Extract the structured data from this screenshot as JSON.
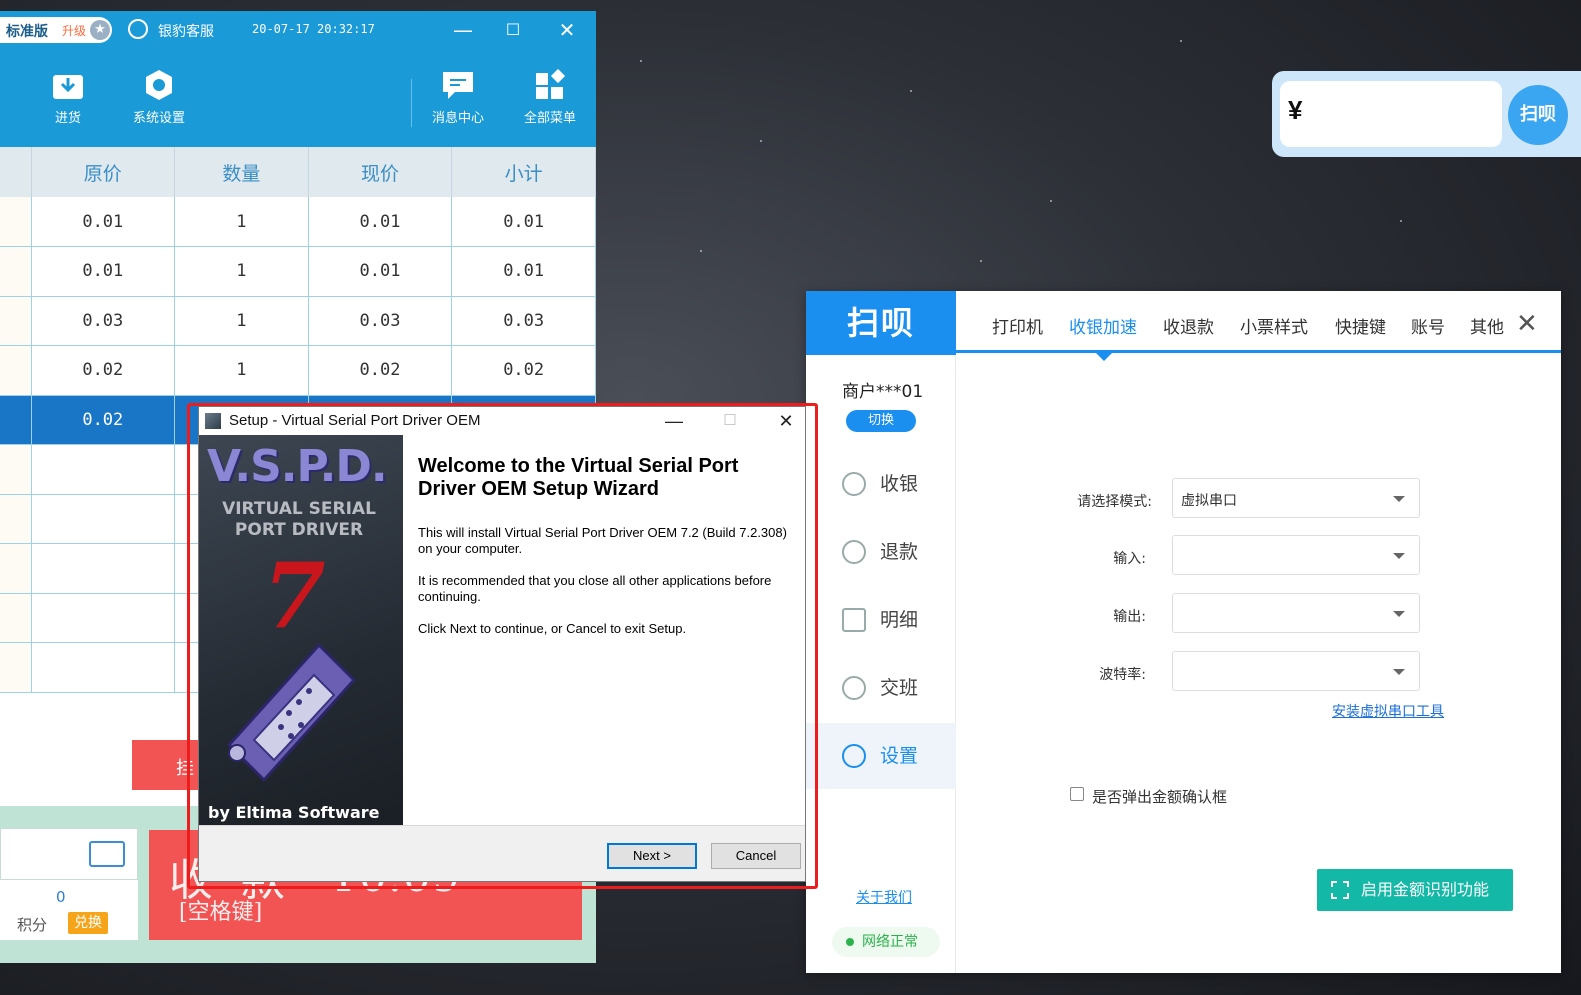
{
  "pos": {
    "edition": "标准版",
    "upgrade": "升级",
    "service": "银豹客服",
    "datetime": "20-07-17 20:32:17",
    "controls": {
      "minimize": "—",
      "maximize": "☐",
      "close": "✕"
    },
    "toolbar": {
      "purchase": "进货",
      "system_settings": "系统设置",
      "message_center": "消息中心",
      "all_menus": "全部菜单"
    },
    "table": {
      "headers": [
        "原价",
        "数量",
        "现价",
        "小计"
      ],
      "rows": [
        [
          "0.01",
          "1",
          "0.01",
          "0.01"
        ],
        [
          "0.01",
          "1",
          "0.01",
          "0.01"
        ],
        [
          "0.03",
          "1",
          "0.03",
          "0.03"
        ],
        [
          "0.02",
          "1",
          "0.02",
          "0.02"
        ],
        [
          "0.02",
          "",
          "",
          ""
        ]
      ]
    },
    "hold_label": "挂",
    "points_value": "0",
    "points_label": "积分",
    "redeem_label": "兑换",
    "checkout": {
      "title": "收款",
      "key_hint": "[空格键]",
      "amount": "¥0.09"
    }
  },
  "amount_widget": {
    "currency": "¥",
    "logo": "扫呗"
  },
  "saobei": {
    "logo": "扫呗",
    "merchant": "商户***01",
    "switch": "切换",
    "tabs": [
      "打印机",
      "收银加速",
      "收退款",
      "小票样式",
      "快捷键",
      "账号",
      "其他"
    ],
    "active_tab": "收银加速",
    "close": "✕",
    "sidebar": [
      "收银",
      "退款",
      "明细",
      "交班",
      "设置"
    ],
    "active_side": "设置",
    "form": {
      "mode_label": "请选择模式:",
      "mode_value": "虚拟串口",
      "input_label": "输入:",
      "output_label": "输出:",
      "baud_label": "波特率:"
    },
    "install_tool": "安装虚拟串口工具",
    "confirm_label": "是否弹出金额确认框",
    "enable_button": "启用金额识别功能",
    "about": "关于我们",
    "network": "网络正常"
  },
  "setup": {
    "title": "Setup - Virtual Serial Port Driver OEM",
    "controls": {
      "minimize": "—",
      "maximize": "☐",
      "close": "✕"
    },
    "banner": {
      "logo": "V.S.P.D.",
      "line1": "VIRTUAL SERIAL",
      "line2": "PORT DRIVER",
      "version": "7",
      "by": "by Eltima Software"
    },
    "heading": "Welcome to the Virtual Serial Port Driver OEM Setup Wizard",
    "para1": "This will install Virtual Serial Port Driver OEM 7.2 (Build 7.2.308) on your computer.",
    "para2": "It is recommended that you close all other applications before continuing.",
    "para3": "Click Next to continue, or Cancel to exit Setup.",
    "next": "Next >",
    "cancel": "Cancel"
  },
  "colors": {
    "pos_blue": "#1b9ad8",
    "selected_row": "#1976c7",
    "checkout_red": "#f25454",
    "saobei_blue": "#1a8ff0",
    "enable_teal": "#14b8a6",
    "highlight_frame": "#ee1d1d"
  }
}
